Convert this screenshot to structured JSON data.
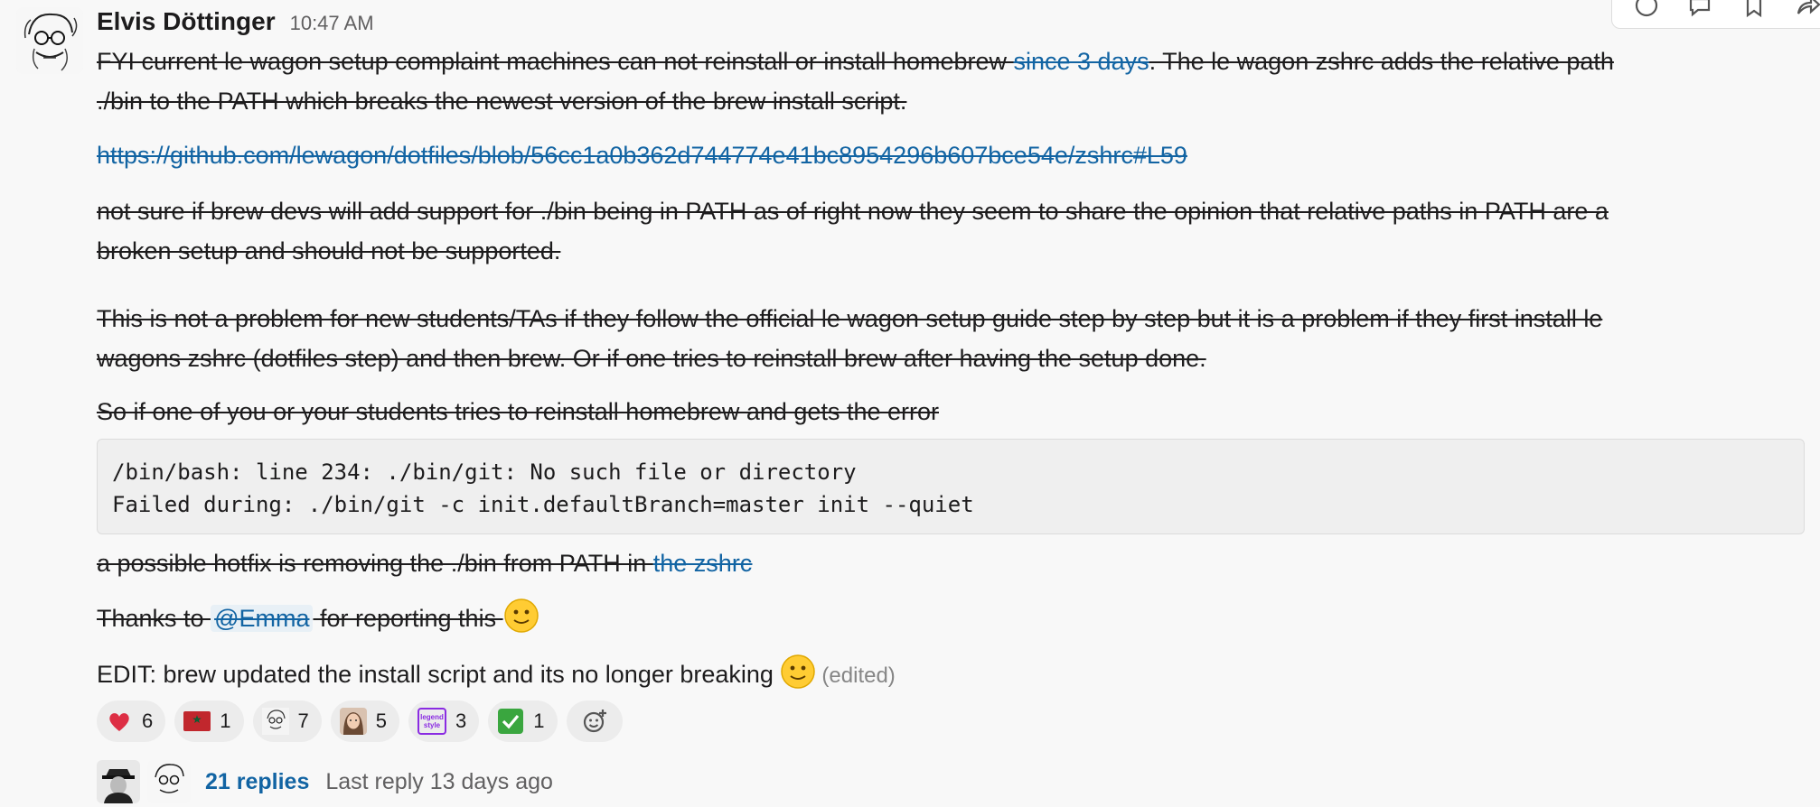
{
  "message": {
    "sender": "Elvis Döttinger",
    "time": "10:47 AM",
    "p1": {
      "before": "FYI current le wagon setup complaint machines can not reinstall or install homebrew ",
      "link": "since 3 days",
      "after_line1": ". The le wagon zshrc adds the relative path",
      "line2": "./bin to the PATH which breaks the newest version of the brew install script."
    },
    "p2_link": "https://github.com/lewagon/dotfiles/blob/56cc1a0b362d744774e41bc8954296b607bce54e/zshrc#L59",
    "p3": {
      "line1": "not sure if brew devs will add support for ./bin being in PATH as of right now they seem to share the opinion that relative paths in PATH are a",
      "line2": "broken setup and should not be supported."
    },
    "p4": {
      "line1": "This is not a problem for new students/TAs if they follow the official le wagon setup guide step by step but it is a problem if they first install le",
      "line2": "wagons zshrc (dotfiles step) and then brew. Or if one tries to reinstall brew after having the setup done."
    },
    "p5": "So if one of you or your students tries to reinstall homebrew and gets the error",
    "code": {
      "line1": "/bin/bash: line 234: ./bin/git: No such file or directory",
      "line2": "Failed during: ./bin/git -c init.defaultBranch=master init --quiet"
    },
    "p6": {
      "before": "a possible hotfix is removing the ./bin from PATH in ",
      "link": "the zshrc"
    },
    "p7": {
      "before": "Thanks to ",
      "mention": "@Emma",
      "after": " for reporting this "
    },
    "p8": {
      "text": "EDIT: brew updated the install script and its no longer breaking ",
      "edited": "(edited)"
    }
  },
  "reactions": [
    {
      "icon": "heart-emoji",
      "count": "6"
    },
    {
      "icon": "morocco-flag-emoji",
      "count": "1"
    },
    {
      "icon": "elvis-avatar-emoji",
      "count": "7"
    },
    {
      "icon": "emma-avatar-emoji",
      "count": "5"
    },
    {
      "icon": "legend-style-emoji",
      "count": "3",
      "label_line1": "legend",
      "label_line2": "style"
    },
    {
      "icon": "check-mark-emoji",
      "count": "1"
    }
  ],
  "thread": {
    "replies": "21 replies",
    "last_reply": "Last reply 13 days ago"
  },
  "colors": {
    "link": "#1264a3",
    "background": "#f8f8f8",
    "code_bg": "#efefef",
    "reaction_bg": "#ececec"
  },
  "toolbar_icons": [
    "emoji-reaction-icon",
    "reply-in-thread-icon",
    "bookmark-icon",
    "share-icon",
    "more-actions-icon"
  ]
}
